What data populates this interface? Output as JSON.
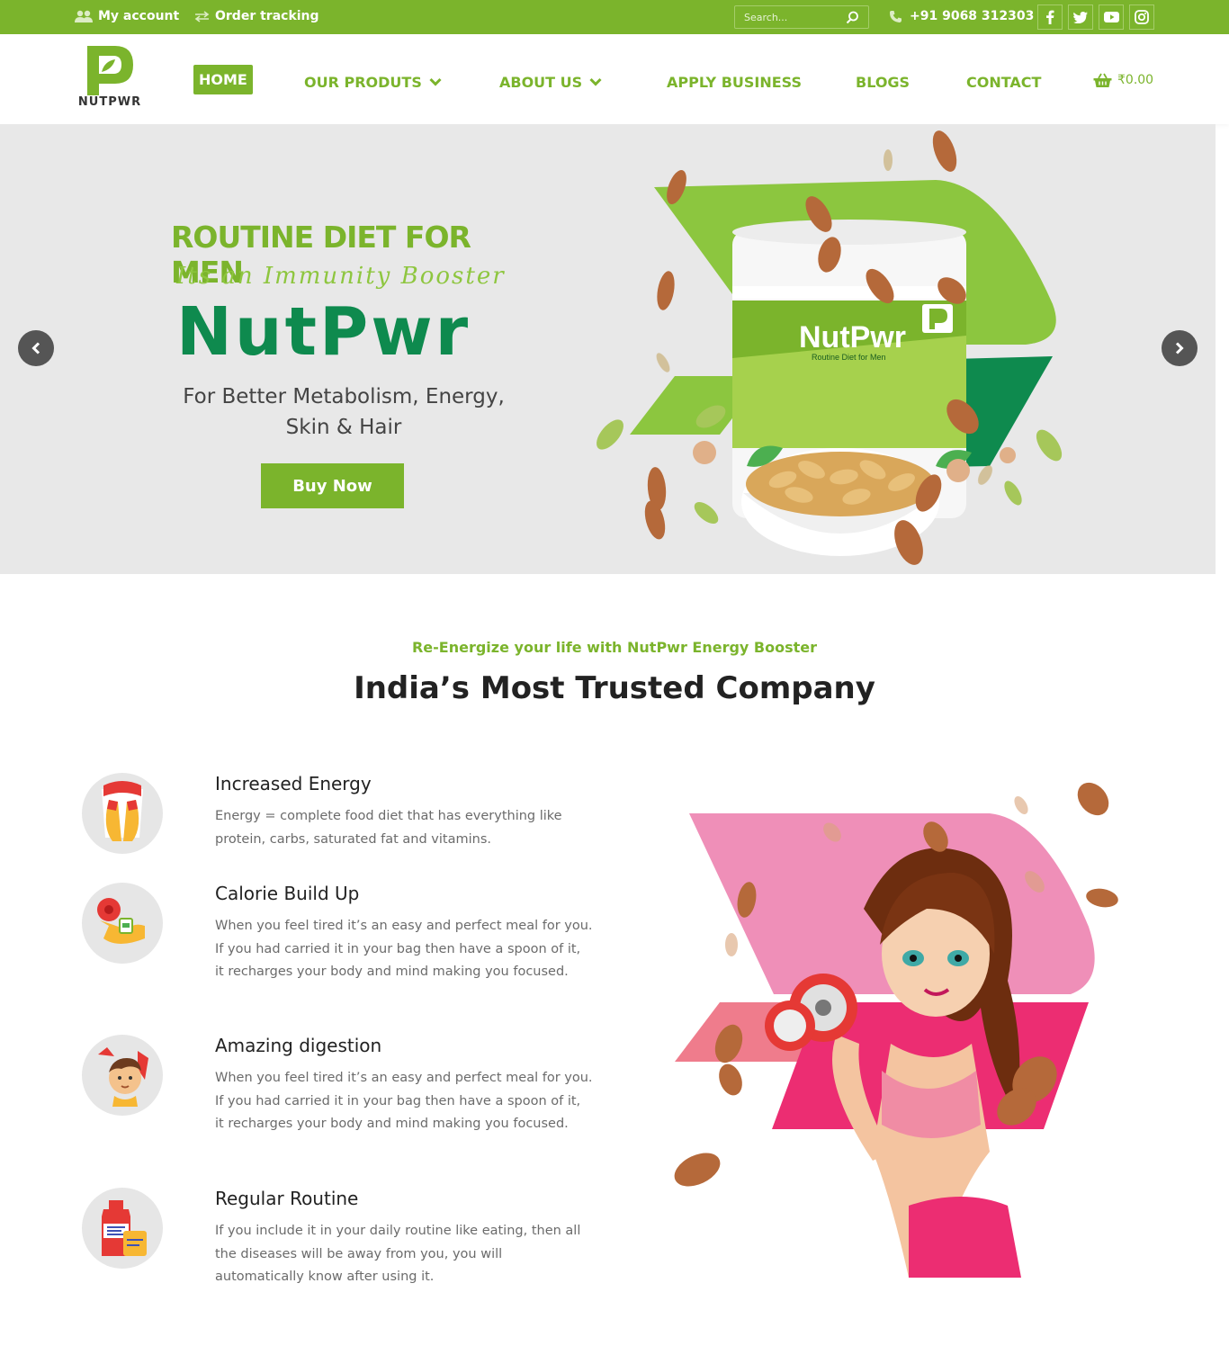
{
  "topbar": {
    "account_label": "My account",
    "tracking_label": "Order tracking",
    "search_placeholder": "Search...",
    "phone": "+91 9068 312303",
    "social": [
      "facebook-icon",
      "twitter-icon",
      "youtube-icon",
      "instagram-icon"
    ]
  },
  "header": {
    "logo_text": "NUTPWR",
    "nav": {
      "home": "HOME",
      "products": "OUR PRODUTS",
      "about": "ABOUT US",
      "apply": "APPLY BUSINESS",
      "blogs": "BLOGS",
      "contact": "CONTACT"
    },
    "cart_total": "₹0.00"
  },
  "hero": {
    "kicker": "ROUTINE DIET FOR MEN",
    "script": "Its an Immunity Booster",
    "brand": "NutPwr",
    "subtitle": "For Better Metabolism, Energy, Skin & Hair",
    "button": "Buy Now",
    "product_label": "NutPwr",
    "product_sub": "Routine Diet for Men"
  },
  "trusted": {
    "kicker": "Re-Energize your life with NutPwr Energy Booster",
    "title": "India’s Most Trusted Company",
    "features": [
      {
        "title": "Increased Energy",
        "text": "Energy = complete food diet that has everything like protein, carbs, saturated fat and vitamins."
      },
      {
        "title": "Calorie Build Up",
        "text": "When you feel tired it’s an easy and perfect meal for you. If you had carried it in your bag then have a spoon of it, it recharges your body and mind making you focused."
      },
      {
        "title": "Amazing digestion",
        "text": "When you feel tired it’s an easy and perfect meal for you. If you had carried it in your bag then have a spoon of it, it recharges your body and mind making you focused."
      },
      {
        "title": "Regular Routine",
        "text": "If you include it in your daily routine like eating, then all the diseases will be away from you, you will automatically know after using it."
      }
    ]
  },
  "colors": {
    "brand_green": "#7bb42c",
    "dark_green": "#0e8a4e",
    "hero_bg": "#e8e8e8",
    "pink": "#ee8fb6"
  }
}
